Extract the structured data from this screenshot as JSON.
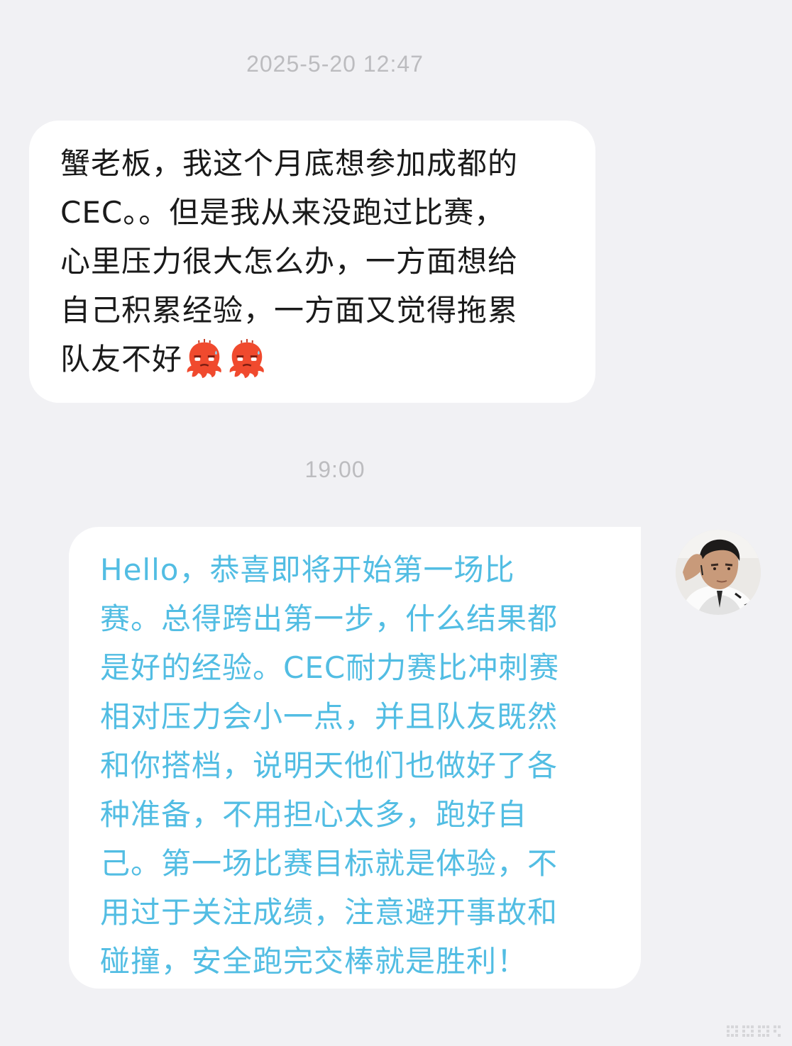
{
  "timestamps": {
    "first": "2025-5-20 12:47",
    "second": "19:00"
  },
  "messages": [
    {
      "side": "incoming",
      "text": "蟹老板，我这个月底想参加成都的\nCEC。。但是我从来没跑过比赛，\n心里压力很大怎么办，一方面想给\n自己积累经验，一方面又觉得拖累\n队友不好",
      "stickers": [
        "red-octopus-sweat-emoji",
        "red-octopus-sweat-emoji"
      ]
    },
    {
      "side": "outgoing",
      "text": "Hello，恭喜即将开始第一场比\n赛。总得跨出第一步，什么结果都\n是好的经验。CEC耐力赛比冲刺赛\n相对压力会小一点，并且队友既然\n和你搭档，说明天他们也做好了各\n种准备，不用担心太多，跑好自\n己。第一场比赛目标就是体验，不\n用过于关注成绩，注意避开事故和\n碰撞，安全跑完交棒就是胜利！"
    }
  ],
  "colors": {
    "background": "#f1f1f4",
    "bubble": "#ffffff",
    "incoming_text": "#1a1a1a",
    "outgoing_text": "#52bde3",
    "timestamp": "#bcbcbf",
    "sticker": "#f04a2e"
  },
  "avatar": {
    "icon": "user-avatar-photo"
  }
}
